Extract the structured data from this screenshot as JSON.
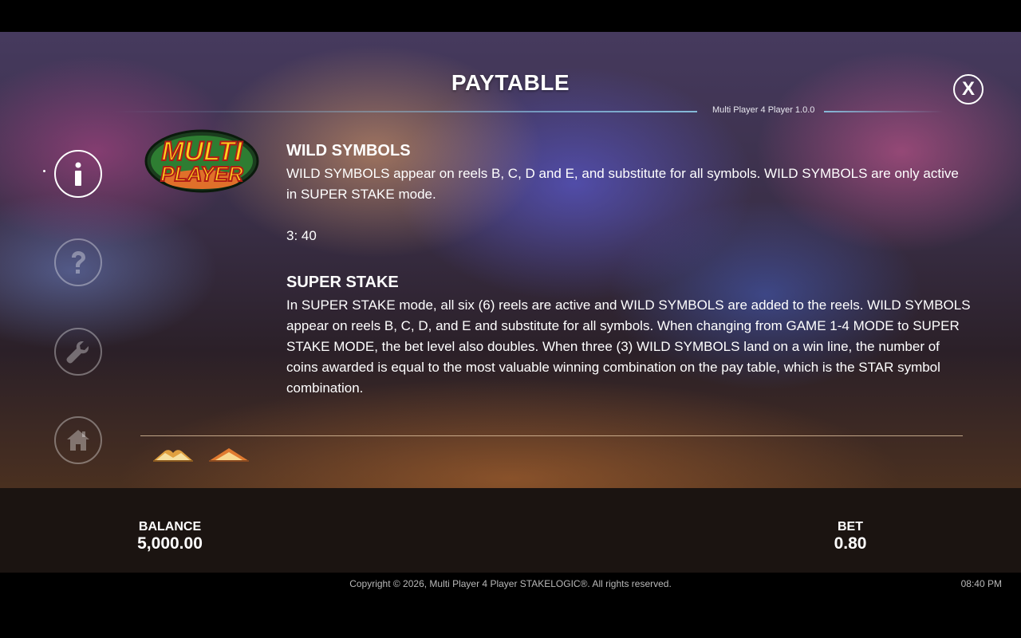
{
  "header": {
    "title": "PAYTABLE",
    "close_label": "X",
    "version": "Multi Player 4 Player 1.0.0"
  },
  "logo": {
    "line1": "MULTI",
    "line2": "PLAYER"
  },
  "wild": {
    "title": "WILD SYMBOLS",
    "text": "WILD SYMBOLS appear on reels B, C, D and E, and substitute for all symbols. WILD SYMBOLS are only active in SUPER STAKE mode.",
    "payout": "3: 40"
  },
  "super_stake": {
    "title": "SUPER STAKE",
    "text": "In SUPER STAKE mode, all six (6) reels are active and WILD SYMBOLS are added to the reels. WILD SYMBOLS appear on reels B, C, D, and E and substitute for all symbols. When changing from GAME 1-4 MODE to SUPER STAKE MODE, the bet level also doubles. When three (3) WILD SYMBOLS land on a win line, the number of coins awarded is equal to the most valuable winning combination on the pay table, which is the STAR symbol combination."
  },
  "nav": [
    {
      "icon": "info-icon",
      "active": true
    },
    {
      "icon": "help-icon",
      "active": false
    },
    {
      "icon": "settings-icon",
      "active": false
    },
    {
      "icon": "home-icon",
      "active": false
    }
  ],
  "status": {
    "balance_label": "BALANCE",
    "balance_value": "5,000.00",
    "bet_label": "BET",
    "bet_value": "0.80"
  },
  "footer": {
    "copyright": "Copyright © 2026, Multi Player 4 Player STAKELOGIC®. All rights reserved.",
    "time": "08:40 PM"
  },
  "colors": {
    "accent_line": "#8cc8e6",
    "logo_yellow": "#ffd21e",
    "logo_red": "#d7261e",
    "logo_green": "#2e7d32"
  }
}
